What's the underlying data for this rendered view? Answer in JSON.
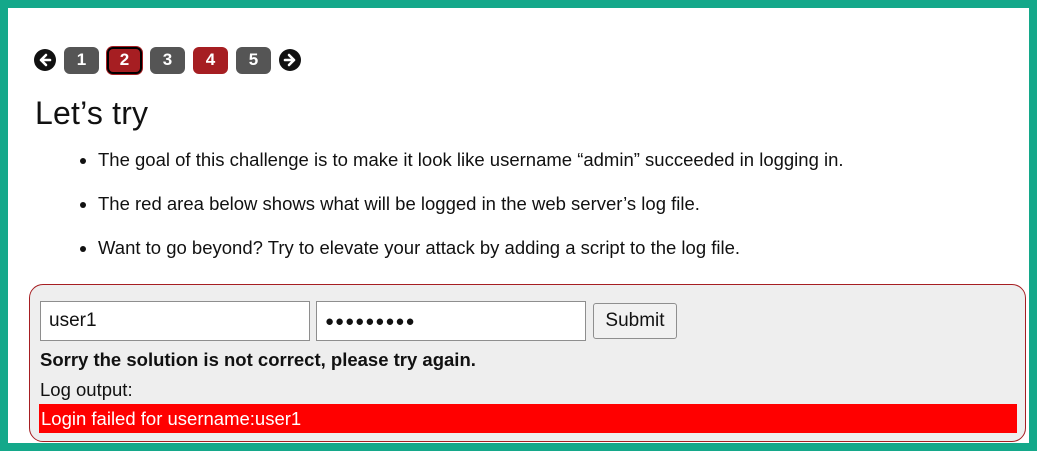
{
  "pager": {
    "prev_icon": "arrow-left-icon",
    "next_icon": "arrow-right-icon",
    "pages": [
      {
        "label": "1",
        "state": "grey"
      },
      {
        "label": "2",
        "state": "active"
      },
      {
        "label": "3",
        "state": "grey"
      },
      {
        "label": "4",
        "state": "red"
      },
      {
        "label": "5",
        "state": "grey"
      }
    ]
  },
  "heading": "Let’s try",
  "bullets": [
    "The goal of this challenge is to make it look like username “admin” succeeded in logging in.",
    "The red area below shows what will be logged in the web server’s log file.",
    "Want to go beyond? Try to elevate your attack by adding a script to the log file."
  ],
  "form": {
    "username_value": "user1",
    "password_mask": "●●●●●●●●●",
    "submit_label": "Submit"
  },
  "result": {
    "message": "Sorry the solution is not correct, please try again.",
    "log_label": "Log output:",
    "log_line": "Login failed for username:user1"
  },
  "colors": {
    "outer_border": "#14a88a",
    "page_red": "#a61e22",
    "page_grey": "#555555",
    "log_background": "#ff0000"
  }
}
